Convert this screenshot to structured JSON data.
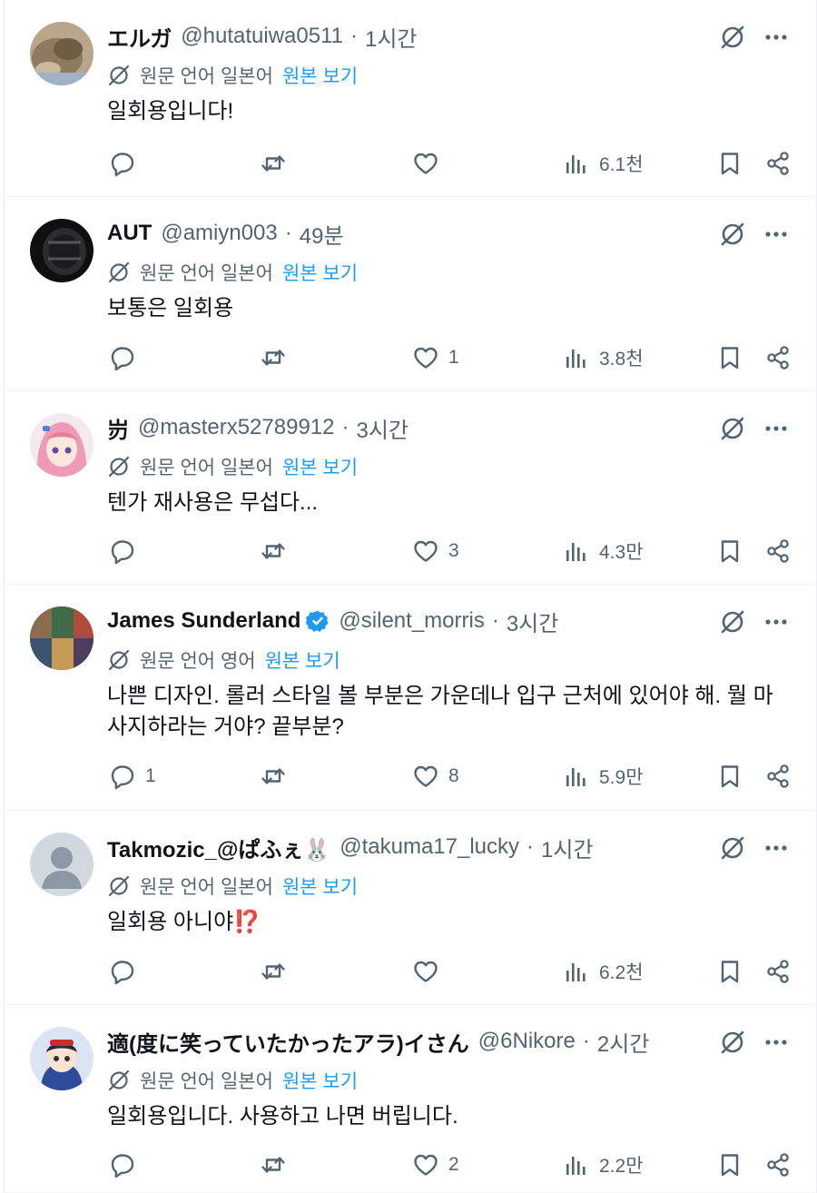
{
  "translate_prefix": "원문 언어",
  "view_original": "원본 보기",
  "tweets": [
    {
      "name": "エルガ",
      "handle": "@hutatuiwa0511",
      "time": "1시간",
      "lang": "일본어",
      "text": "일회용입니다!",
      "verified": false,
      "replies": "",
      "retweets": "",
      "likes": "",
      "views": "6.1천",
      "avatar": "cat-photo"
    },
    {
      "name": "AUT",
      "handle": "@amiyn003",
      "time": "49분",
      "lang": "일본어",
      "text": "보통은 일회용",
      "verified": false,
      "replies": "",
      "retweets": "",
      "likes": "1",
      "views": "3.8천",
      "avatar": "dark-object-photo"
    },
    {
      "name": "岃",
      "handle": "@masterx52789912",
      "time": "3시간",
      "lang": "일본어",
      "text": "텐가 재사용은 무섭다...",
      "verified": false,
      "replies": "",
      "retweets": "",
      "likes": "3",
      "views": "4.3만",
      "avatar": "anime-pink-hair"
    },
    {
      "name": "James Sunderland",
      "handle": "@silent_morris",
      "time": "3시간",
      "lang": "영어",
      "text": "나쁜 디자인. 롤러 스타일 볼 부분은 가운데나 입구 근처에 있어야 해. 뭘 마사지하라는 거야? 끝부분?",
      "verified": true,
      "replies": "1",
      "retweets": "",
      "likes": "8",
      "views": "5.9만",
      "avatar": "collage-photo"
    },
    {
      "name": "Takmozic_@ぱふぇ🐰",
      "handle": "@takuma17_lucky",
      "time": "1시간",
      "lang": "일본어",
      "text": "일회용 아니야⁉️",
      "verified": false,
      "replies": "",
      "retweets": "",
      "likes": "",
      "views": "6.2천",
      "avatar": "default-avatar"
    },
    {
      "name": "適(度に笑っていたかったアラ)イさん",
      "handle": "@6Nikore",
      "time": "2시간",
      "lang": "일본어",
      "text": "일회용입니다. 사용하고 나면 버립니다.",
      "verified": false,
      "replies": "",
      "retweets": "",
      "likes": "2",
      "views": "2.2만",
      "avatar": "anime-character"
    }
  ],
  "colors": {
    "link": "#1d9bf0",
    "secondary": "#536471",
    "text": "#0f1419",
    "verified": "#1d9bf0"
  }
}
